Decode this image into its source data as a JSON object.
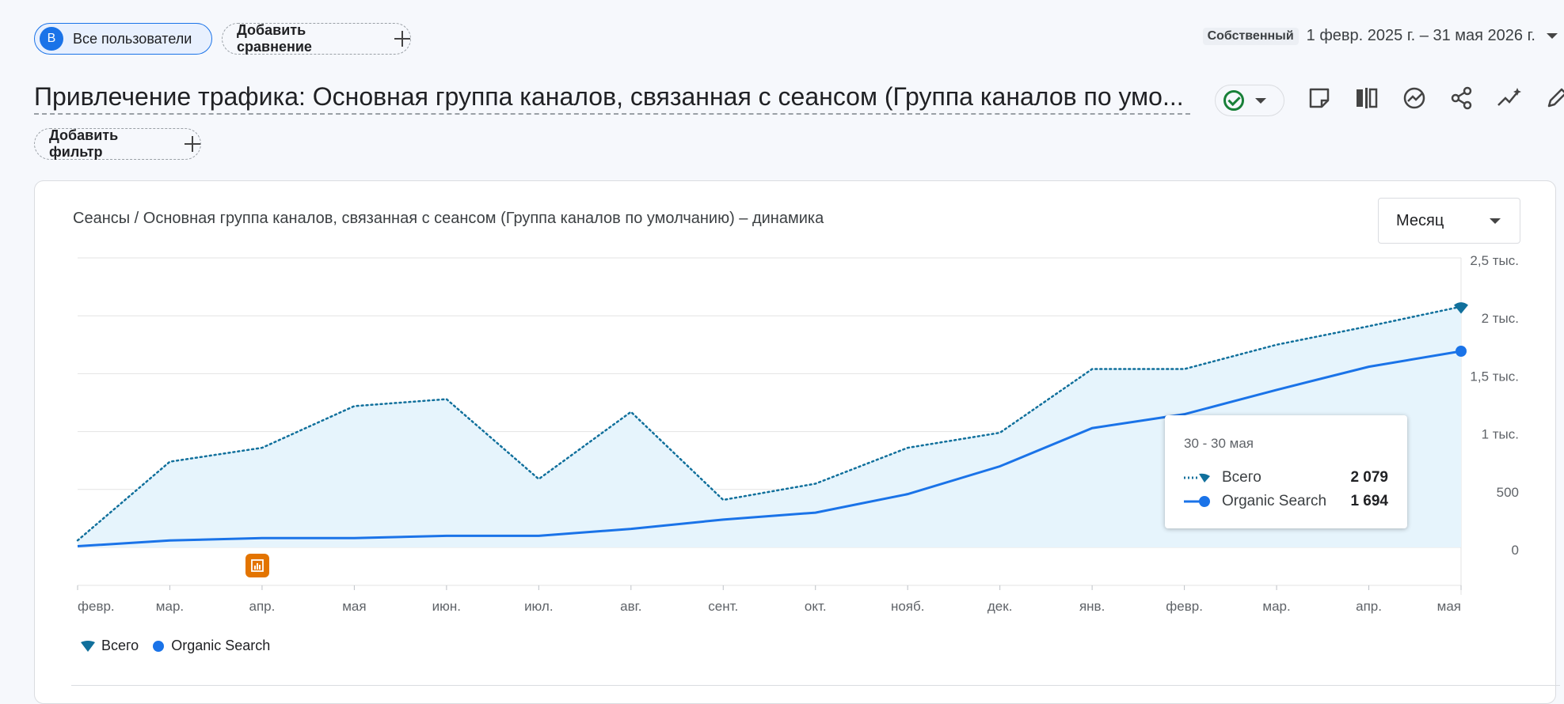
{
  "header": {
    "segment_avatar": "В",
    "segment_label": "Все пользователи",
    "compare_label": "Добавить сравнение",
    "date_tag": "Собственный",
    "date_range": "1 февр. 2025 г. – 31 мая 2026 г."
  },
  "report": {
    "title": "Привлечение трафика: Основная группа каналов, связанная с сеансом (Группа каналов по умо...",
    "filter_label": "Добавить фильтр"
  },
  "chart_card": {
    "title": "Сеансы / Основная группа каналов, связанная с сеансом (Группа каналов по умолчанию) – динамика",
    "granularity": "Месяц"
  },
  "tooltip": {
    "date": "30 - 30 мая",
    "rows": [
      {
        "label": "Всего",
        "value": "2 079"
      },
      {
        "label": "Organic Search",
        "value": "1 694"
      }
    ]
  },
  "legend": [
    "Всего",
    "Organic Search"
  ],
  "colors": {
    "accent": "#1a73e8",
    "total_line": "#11709c",
    "area_fill": "#e6f4fc",
    "annotation": "#e37400"
  },
  "chart_data": {
    "type": "line",
    "categories": [
      "февр.",
      "мар.",
      "апр.",
      "мая",
      "июн.",
      "июл.",
      "авг.",
      "сент.",
      "окт.",
      "нояб.",
      "дек.",
      "янв.",
      "февр.",
      "мар.",
      "апр.",
      "мая"
    ],
    "yticks": [
      "0",
      "500",
      "1 тыс.",
      "1,5 тыс.",
      "2 тыс.",
      "2,5 тыс."
    ],
    "ylim": [
      0,
      2500
    ],
    "grid": true,
    "legend_position": "bottom-left",
    "series": [
      {
        "name": "Всего",
        "style": "dotted",
        "values": [
          60,
          740,
          860,
          1220,
          1280,
          590,
          1170,
          410,
          550,
          860,
          990,
          1540,
          1540,
          1750,
          1910,
          2079
        ]
      },
      {
        "name": "Organic Search",
        "style": "solid",
        "values": [
          10,
          60,
          80,
          80,
          100,
          100,
          160,
          240,
          300,
          460,
          700,
          1030,
          1150,
          1360,
          1560,
          1694
        ]
      }
    ]
  }
}
